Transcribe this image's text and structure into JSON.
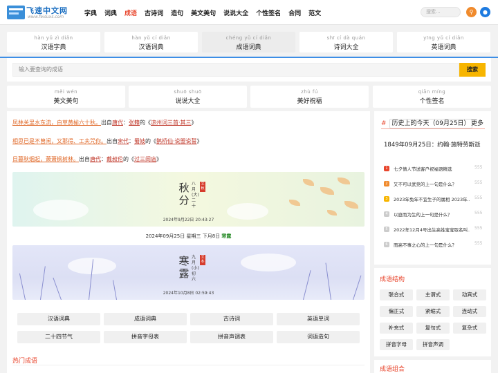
{
  "logo": {
    "title": "飞速中文网",
    "sub": "www.feisuxs.com",
    "icon_text": "飞速"
  },
  "nav": [
    "字典",
    "词典",
    "成语",
    "古诗词",
    "造句",
    "美文美句",
    "说说大全",
    "个性签名",
    "合同",
    "范文"
  ],
  "nav_active": 2,
  "search_top": {
    "placeholder": "搜索..."
  },
  "tabs_top": [
    {
      "py": "hàn yǔ zì diǎn",
      "cn": "汉语字典"
    },
    {
      "py": "hàn yǔ cí diǎn",
      "cn": "汉语词典"
    },
    {
      "py": "chéng yǔ cí diǎn",
      "cn": "成语词典",
      "selected": true
    },
    {
      "py": "shī cí dà quán",
      "cn": "诗词大全"
    },
    {
      "py": "yīng yǔ cí diǎn",
      "cn": "英语词典"
    }
  ],
  "main_search": {
    "placeholder": "输入要查询的成语",
    "button": "搜索"
  },
  "tabs_second": [
    {
      "py": "měi wén",
      "cn": "美文美句"
    },
    {
      "py": "shuō shuō",
      "cn": "说说大全"
    },
    {
      "py": "zhù fú",
      "cn": "美好祝福"
    },
    {
      "py": "qiān míng",
      "cn": "个性签名"
    }
  ],
  "poems": [
    {
      "line": "凤林关里水东流，白草黄榆六十秋。",
      "mid": "出自",
      "dyn": "唐代",
      "sep": "：",
      "author": "张籍",
      "of": "的《",
      "title": "凉州词三首·其三",
      "close": "》"
    },
    {
      "line": "相思已是不曾闲，又那得、工夫咒你。",
      "mid": "出自",
      "dyn": "宋代",
      "sep": "：",
      "author": "蜀妓",
      "of": "的《",
      "title": "鹊桥仙·说盟说誓",
      "close": "》"
    },
    {
      "line": "日暮秋烟起，萧萧枫树林。",
      "mid": "出自",
      "dyn": "唐代",
      "sep": "：",
      "author": "戴叔伦",
      "of": "的《",
      "title": "过三闾庙",
      "close": "》"
    }
  ],
  "term1": {
    "name1": "秋",
    "name2": "分",
    "sub": "八月(大)二十",
    "seal": "立秋",
    "date": "2024年9月22日 20:43:27"
  },
  "dateline": {
    "text": "2024年09月25日 星期三 下月8日",
    "term": "寒露"
  },
  "term2": {
    "name1": "寒",
    "name2": "露",
    "sub": "九月(小)初六",
    "seal": "立冬",
    "date": "2024年10月8日 02:59:43"
  },
  "links": [
    "汉语词典",
    "成语词典",
    "古诗词",
    "英语单词",
    "二十四节气",
    "拼音字母表",
    "拼音声调表",
    "词语造句"
  ],
  "hot_title": "热门成语",
  "history": {
    "hash": "#",
    "title": "历史上的今天（09月25日）",
    "more": "更多",
    "event": "1849年09月25日：约翰·施特劳斯逝"
  },
  "hist_list": [
    {
      "num": "1",
      "text": "七夕情人节送客户祝福语精选",
      "count": "555",
      "color": "#e8452c"
    },
    {
      "num": "2",
      "text": "又不可以武竞的上一句是什么？",
      "count": "555",
      "color": "#f08a2c"
    },
    {
      "num": "3",
      "text": "2023年兔年不宜生子的属相 2023年...",
      "count": "555",
      "color": "#f7b500"
    },
    {
      "num": "4",
      "text": "以庭而为生的上一句是什么？",
      "count": "555",
      "color": "#cccccc"
    },
    {
      "num": "5",
      "text": "2022年12月4号出生高姓宝宝取名叫...",
      "count": "555",
      "color": "#cccccc"
    },
    {
      "num": "6",
      "text": "而高不事之心的上一句是什么？",
      "count": "555",
      "color": "#cccccc"
    }
  ],
  "structure": {
    "title": "成语结构",
    "items": [
      "联合式",
      "主谓式",
      "动宾式",
      "偏正式",
      "紧缩式",
      "连动式",
      "补充式",
      "复句式",
      "复杂式",
      "拼音字母",
      "拼音声调"
    ]
  },
  "combo": {
    "title": "成语组合"
  }
}
